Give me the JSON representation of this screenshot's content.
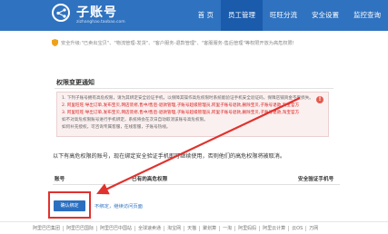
{
  "header": {
    "title": "子账号",
    "subtitle": "zizhanghao.taobao.com",
    "nav": [
      "首 页",
      "员工管理",
      "旺旺分流",
      "安全设置",
      "监控查询"
    ],
    "active_index": 1
  },
  "notice": "安全升级:\"已卖出宝贝\"、\"物流管理-发货\"、\"客户服务-退款管理\"、\"客服服务-售后管理\"等权限开放为高危权限!",
  "section": {
    "title": "权限变更通知"
  },
  "warning": {
    "line1": "1. 下列子账号拥有高危权限，请为其绑定安全验证手机，以保障其操作高危权限时系统能验证手机安全验证码，保障店铺资金不受损失。",
    "line2": "2. 阿里旺旺:导出订单,发布宝贝,网店装修,售中/售后-退款管理,子账号超级管理员,阿里子账号退款,删除宝贝,子账号退款,淘宝官方",
    "line3": "3. 阿里旺旺:导出订单,发布宝贝,网店装修,售中/售后-退款管理,子账号超级管理员,阿里子账号退款,删除宝贝,子账号退款,淘宝官方",
    "line4": "如不对高危权限账号进行手机绑定，系统将会在次日自动取消该账号高危权限。",
    "line5": "如何补充授权，可咨询专属客服，在线客服，子账号热线。"
  },
  "description": "以下有高危权限的账号，现在绑定安全验证手机即可继续使用，否则他们的高危权限将被取消。",
  "table": {
    "headers": [
      "账号",
      "已有的高危权限",
      "安全验证手机号"
    ]
  },
  "actions": {
    "primary": "确认绑定",
    "links": "不绑定，继续访问页面"
  },
  "footer": {
    "links": [
      "阿里巴巴集团",
      "阿里巴巴国际",
      "阿里巴巴中国站",
      "全球速卖通",
      "淘宝网",
      "天猫",
      "聚划算",
      "一淘",
      "阿里妈妈",
      "阿里云计算",
      "云OS",
      "万网"
    ]
  },
  "colors": {
    "header_bg": "#2f72c0",
    "active_nav": "#1a5bab",
    "warning_red": "#d8201f",
    "annotation_red": "#e0322e"
  }
}
